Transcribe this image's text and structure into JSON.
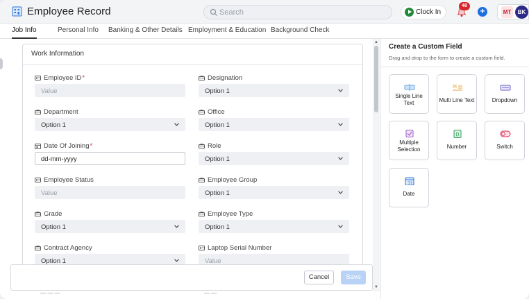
{
  "app": {
    "title": "Employee Record"
  },
  "search": {
    "placeholder": "Search"
  },
  "header": {
    "clock_in_label": "Clock In",
    "notification_count": "48",
    "avatar1": "MT",
    "avatar2": "BK"
  },
  "tabs": [
    {
      "label": "Job Info",
      "active": true
    },
    {
      "label": "Personal Info"
    },
    {
      "label": "Banking & Other Details"
    },
    {
      "label": "Employment & Education"
    },
    {
      "label": "Background Check"
    }
  ],
  "form": {
    "section_title": "Work Information",
    "fields": [
      {
        "label": "Employee ID",
        "required": "*",
        "type": "input",
        "value": "Value"
      },
      {
        "label": "Designation",
        "type": "select",
        "value": "Option 1"
      },
      {
        "label": "Department",
        "type": "select",
        "value": "Option 1"
      },
      {
        "label": "Office",
        "type": "select",
        "value": "Option 1"
      },
      {
        "label": "Date Of Joining",
        "required": "*",
        "type": "date",
        "value": "dd-mm-yyyy"
      },
      {
        "label": "Role",
        "type": "select",
        "value": "Option 1"
      },
      {
        "label": "Employee Status",
        "type": "input",
        "value": "Value"
      },
      {
        "label": "Employee Group",
        "type": "select",
        "value": "Option 1"
      },
      {
        "label": "Grade",
        "type": "select",
        "value": "Option 1"
      },
      {
        "label": "Employee Type",
        "type": "select",
        "value": "Option 1"
      },
      {
        "label": "Contract Agency",
        "type": "select",
        "value": "Option 1"
      },
      {
        "label": "Laptop Serial Number",
        "type": "input",
        "value": "Value"
      }
    ]
  },
  "footer": {
    "cancel_label": "Cancel",
    "save_label": "Save"
  },
  "custom_field": {
    "title": "Create a Custom Field",
    "subtitle": "Drag and drop to the form to create a custom field.",
    "tiles": [
      {
        "label": "Single Line Text",
        "icon": "single-line-text-icon"
      },
      {
        "label": "Multi Line Text",
        "icon": "multi-line-text-icon"
      },
      {
        "label": "Dropdown",
        "icon": "dropdown-icon"
      },
      {
        "label": "Multiple Selection",
        "icon": "multiple-selection-icon"
      },
      {
        "label": "Number",
        "icon": "number-icon"
      },
      {
        "label": "Switch",
        "icon": "switch-icon"
      },
      {
        "label": "Date",
        "icon": "date-icon"
      }
    ]
  },
  "colors": {
    "accent": "#1e6fe0",
    "required": "#d7262b",
    "clock": "#1f8a3a",
    "save_disabled": "#b9d3f6"
  }
}
